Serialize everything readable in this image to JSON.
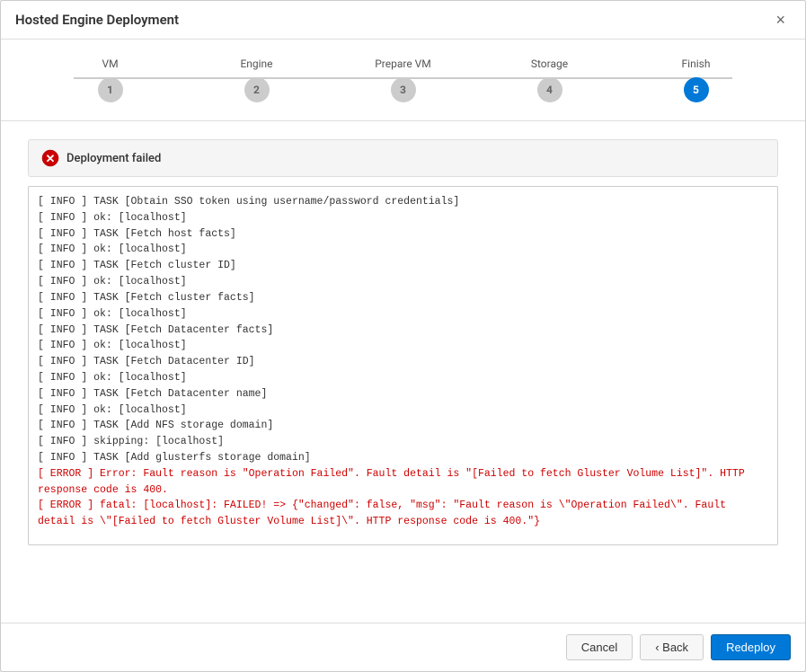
{
  "dialog": {
    "title": "Hosted Engine Deployment",
    "close_label": "×"
  },
  "stepper": {
    "steps": [
      {
        "id": 1,
        "label": "VM",
        "active": false
      },
      {
        "id": 2,
        "label": "Engine",
        "active": false
      },
      {
        "id": 3,
        "label": "Prepare VM",
        "active": false
      },
      {
        "id": 4,
        "label": "Storage",
        "active": false
      },
      {
        "id": 5,
        "label": "Finish",
        "active": true
      }
    ]
  },
  "alert": {
    "text": "Deployment failed"
  },
  "log": {
    "lines": [
      {
        "text": "[ INFO ] TASK [Obtain SSO token using username/password credentials]",
        "type": "normal"
      },
      {
        "text": "[ INFO ] ok: [localhost]",
        "type": "normal"
      },
      {
        "text": "[ INFO ] TASK [Fetch host facts]",
        "type": "normal"
      },
      {
        "text": "[ INFO ] ok: [localhost]",
        "type": "normal"
      },
      {
        "text": "[ INFO ] TASK [Fetch cluster ID]",
        "type": "normal"
      },
      {
        "text": "[ INFO ] ok: [localhost]",
        "type": "normal"
      },
      {
        "text": "[ INFO ] TASK [Fetch cluster facts]",
        "type": "normal"
      },
      {
        "text": "[ INFO ] ok: [localhost]",
        "type": "normal"
      },
      {
        "text": "[ INFO ] TASK [Fetch Datacenter facts]",
        "type": "normal"
      },
      {
        "text": "[ INFO ] ok: [localhost]",
        "type": "normal"
      },
      {
        "text": "[ INFO ] TASK [Fetch Datacenter ID]",
        "type": "normal"
      },
      {
        "text": "[ INFO ] ok: [localhost]",
        "type": "normal"
      },
      {
        "text": "[ INFO ] TASK [Fetch Datacenter name]",
        "type": "normal"
      },
      {
        "text": "[ INFO ] ok: [localhost]",
        "type": "normal"
      },
      {
        "text": "[ INFO ] TASK [Add NFS storage domain]",
        "type": "normal"
      },
      {
        "text": "[ INFO ] skipping: [localhost]",
        "type": "normal"
      },
      {
        "text": "[ INFO ] TASK [Add glusterfs storage domain]",
        "type": "normal"
      },
      {
        "text": "[ ERROR ] Error: Fault reason is \"Operation Failed\". Fault detail is \"[Failed to fetch Gluster Volume List]\". HTTP response code is 400.",
        "type": "error"
      },
      {
        "text": "[ ERROR ] fatal: [localhost]: FAILED! => {\"changed\": false, \"msg\": \"Fault reason is \\\"Operation Failed\\\". Fault detail is \\\"[Failed to fetch Gluster Volume List]\\\". HTTP response code is 400.\"}",
        "type": "error"
      }
    ]
  },
  "footer": {
    "cancel_label": "Cancel",
    "back_label": "‹ Back",
    "redeploy_label": "Redeploy"
  }
}
